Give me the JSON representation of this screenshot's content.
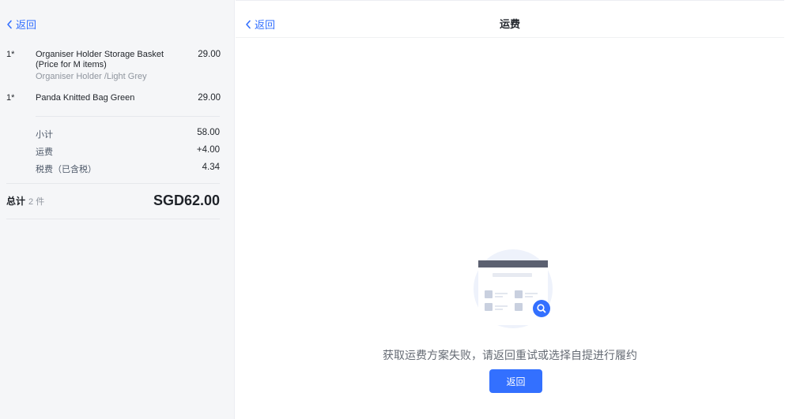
{
  "order_panel": {
    "back_label": "返回",
    "items": [
      {
        "qty": "1*",
        "name": "Organiser Holder Storage Basket (Price for M items)",
        "variant": "Organiser Holder /Light Grey",
        "price": "29.00"
      },
      {
        "qty": "1*",
        "name": "Panda Knitted Bag Green",
        "variant": "",
        "price": "29.00"
      }
    ],
    "summary": {
      "subtotal_label": "小计",
      "subtotal_value": "58.00",
      "shipping_label": "运费",
      "shipping_value": "+4.00",
      "tax_label": "税费（已含税）",
      "tax_value": "4.34"
    },
    "total": {
      "label": "总计",
      "count": "2 件",
      "amount": "SGD62.00"
    }
  },
  "shipping_panel": {
    "back_label": "返回",
    "title": "运费",
    "empty_message": "获取运费方案失败，请返回重试或选择自提进行履约",
    "retry_label": "返回",
    "illustration_icon": "empty-search-illustration",
    "colors": {
      "accent": "#3370ff",
      "panel_bg": "#f5f6f8"
    }
  }
}
